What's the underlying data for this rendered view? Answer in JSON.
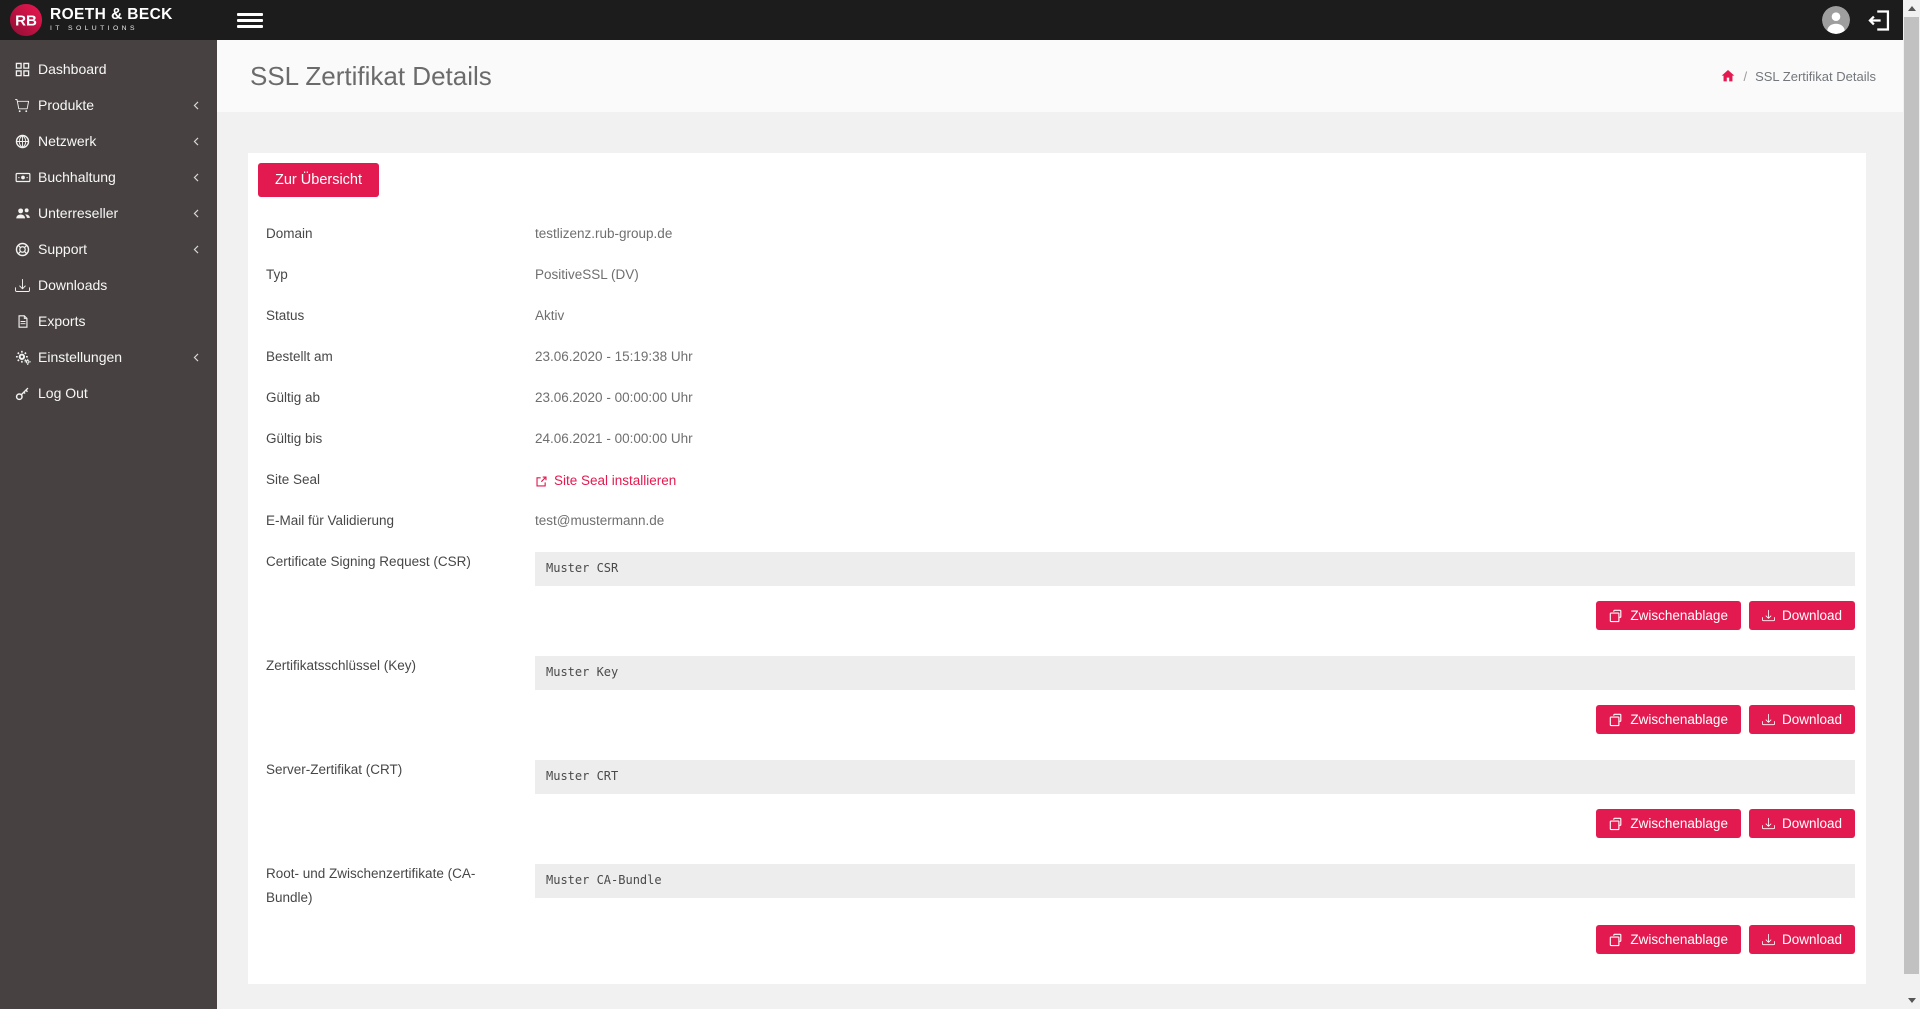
{
  "colors": {
    "accent": "#e21a4f",
    "topbar_bg": "#1c1c1c",
    "sidebar_bg": "#474241",
    "card_bg": "#ffffff",
    "body_bg": "#f1f1f1",
    "textarea_bg": "#ededed"
  },
  "brand": {
    "monogram": "RB",
    "name": "ROETH & BECK",
    "tagline": "IT SOLUTIONS"
  },
  "topbar": {
    "icons": [
      "hamburger-menu-icon",
      "user-avatar-icon",
      "logout-icon"
    ]
  },
  "sidebar": {
    "items": [
      {
        "label": "Dashboard",
        "icon": "dashboard-grid-icon",
        "expandable": false
      },
      {
        "label": "Produkte",
        "icon": "cart-icon",
        "expandable": true
      },
      {
        "label": "Netzwerk",
        "icon": "globe-icon",
        "expandable": true
      },
      {
        "label": "Buchhaltung",
        "icon": "money-icon",
        "expandable": true
      },
      {
        "label": "Unterreseller",
        "icon": "users-icon",
        "expandable": true
      },
      {
        "label": "Support",
        "icon": "life-ring-icon",
        "expandable": true
      },
      {
        "label": "Downloads",
        "icon": "download-icon",
        "expandable": false
      },
      {
        "label": "Exports",
        "icon": "file-icon",
        "expandable": false
      },
      {
        "label": "Einstellungen",
        "icon": "gears-icon",
        "expandable": true
      },
      {
        "label": "Log Out",
        "icon": "key-icon",
        "expandable": false
      }
    ]
  },
  "header": {
    "title": "SSL Zertifikat Details",
    "breadcrumb": {
      "home_icon": "home-icon",
      "separator": "/",
      "current": "SSL Zertifikat Details"
    }
  },
  "content": {
    "back_button": "Zur Übersicht",
    "fields": [
      {
        "label": "Domain",
        "value": "testlizenz.rub-group.de"
      },
      {
        "label": "Typ",
        "value": "PositiveSSL (DV)"
      },
      {
        "label": "Status",
        "value": "Aktiv"
      },
      {
        "label": "Bestellt am",
        "value": "23.06.2020 - 15:19:38 Uhr"
      },
      {
        "label": "Gültig ab",
        "value": "23.06.2020 - 00:00:00 Uhr"
      },
      {
        "label": "Gültig bis",
        "value": "24.06.2021 - 00:00:00 Uhr"
      }
    ],
    "site_seal": {
      "label": "Site Seal",
      "link_text": "Site Seal installieren",
      "icon": "external-link-icon"
    },
    "email": {
      "label": "E-Mail für Validierung",
      "value": "test@mustermann.de"
    },
    "cert_blocks": [
      {
        "label": "Certificate Signing Request (CSR)",
        "value": "Muster CSR"
      },
      {
        "label": "Zertifikatsschlüssel (Key)",
        "value": "Muster Key"
      },
      {
        "label": "Server-Zertifikat (CRT)",
        "value": "Muster CRT"
      },
      {
        "label": "Root- und Zwischenzertifikate (CA-Bundle)",
        "value": "Muster CA-Bundle"
      }
    ],
    "copy_button": "Zwischenablage",
    "download_button": "Download"
  }
}
